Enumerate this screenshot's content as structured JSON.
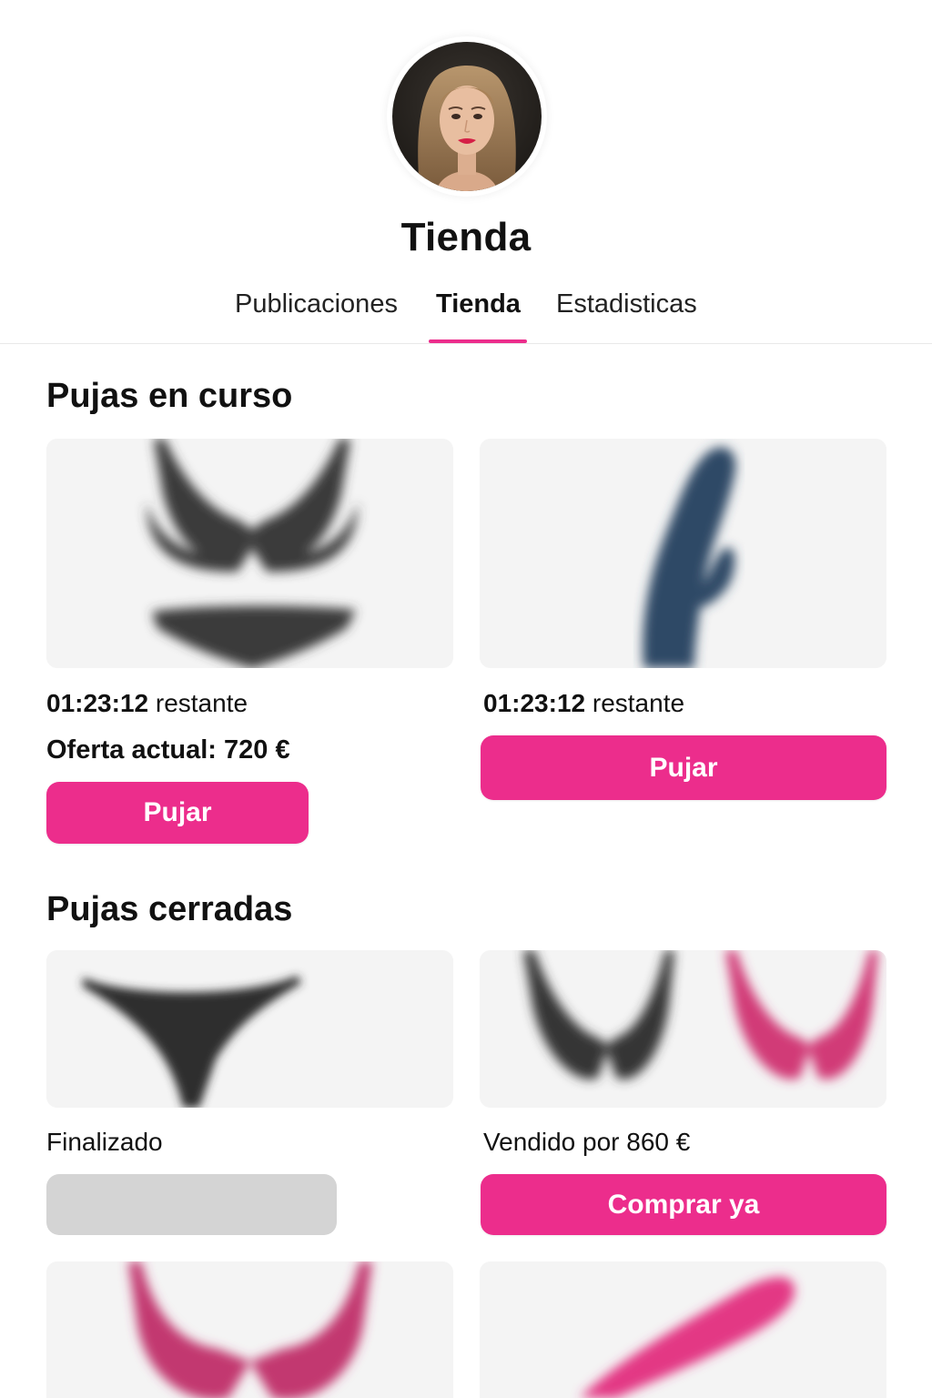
{
  "profile": {
    "title": "Tienda"
  },
  "tabs": [
    {
      "label": "Publicaciones",
      "active": false
    },
    {
      "label": "Tienda",
      "active": true
    },
    {
      "label": "Estadisticas",
      "active": false
    }
  ],
  "colors": {
    "accent": "#ec2d8c",
    "disabled_button": "#d4d4d4"
  },
  "active_auctions": {
    "title": "Pujas en curso",
    "items": [
      {
        "image": "lingerie-set-black",
        "time_left": "01:23:12",
        "time_suffix": "restante",
        "current_offer": "Oferta actual: 720 €",
        "button_label": "Pujar"
      },
      {
        "image": "toy-blue",
        "time_left": "01:23:12",
        "time_suffix": "restante",
        "button_label": "Pujar"
      }
    ]
  },
  "closed_auctions": {
    "title": "Pujas cerradas",
    "items": [
      {
        "image": "thong-black",
        "status": "Finalizado",
        "button_disabled": true
      },
      {
        "image": "bras-black-pink",
        "status": "Vendido por 860 €",
        "button_label": "Comprar ya"
      },
      {
        "image": "bra-pink"
      },
      {
        "image": "toy-pink"
      }
    ]
  }
}
